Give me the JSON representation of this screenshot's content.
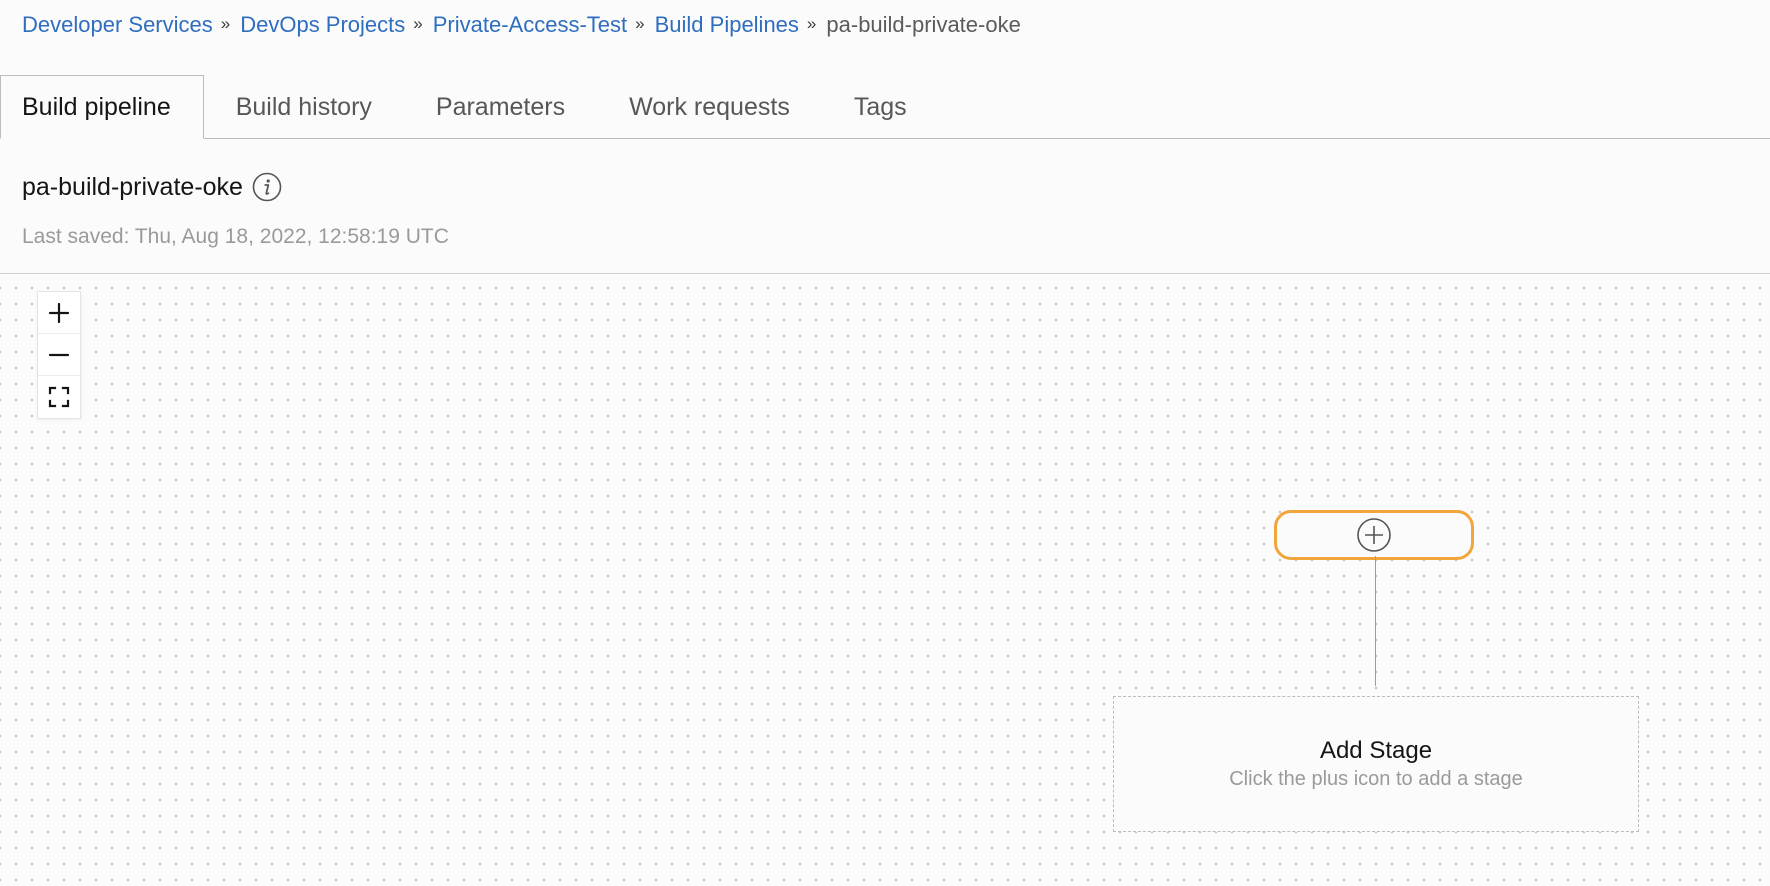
{
  "breadcrumb": {
    "items": [
      {
        "label": "Developer Services"
      },
      {
        "label": "DevOps Projects"
      },
      {
        "label": "Private-Access-Test"
      },
      {
        "label": "Build Pipelines"
      }
    ],
    "separator": "»",
    "current": "pa-build-private-oke"
  },
  "tabs": [
    {
      "label": "Build pipeline",
      "active": true
    },
    {
      "label": "Build history",
      "active": false
    },
    {
      "label": "Parameters",
      "active": false
    },
    {
      "label": "Work requests",
      "active": false
    },
    {
      "label": "Tags",
      "active": false
    }
  ],
  "header": {
    "title": "pa-build-private-oke",
    "info_icon": "info-icon",
    "last_saved": "Last saved: Thu, Aug 18, 2022, 12:58:19 UTC"
  },
  "canvas": {
    "zoom_controls": [
      "zoom-in-icon",
      "zoom-out-icon",
      "fit-to-screen-icon"
    ],
    "start_node_icon": "plus-circle-icon",
    "add_stage": {
      "title": "Add Stage",
      "hint": "Click the plus icon to add a stage"
    }
  },
  "colors": {
    "link": "#2f6ebf",
    "node_border": "#f0a63c",
    "muted_text": "#9a9a9a"
  }
}
